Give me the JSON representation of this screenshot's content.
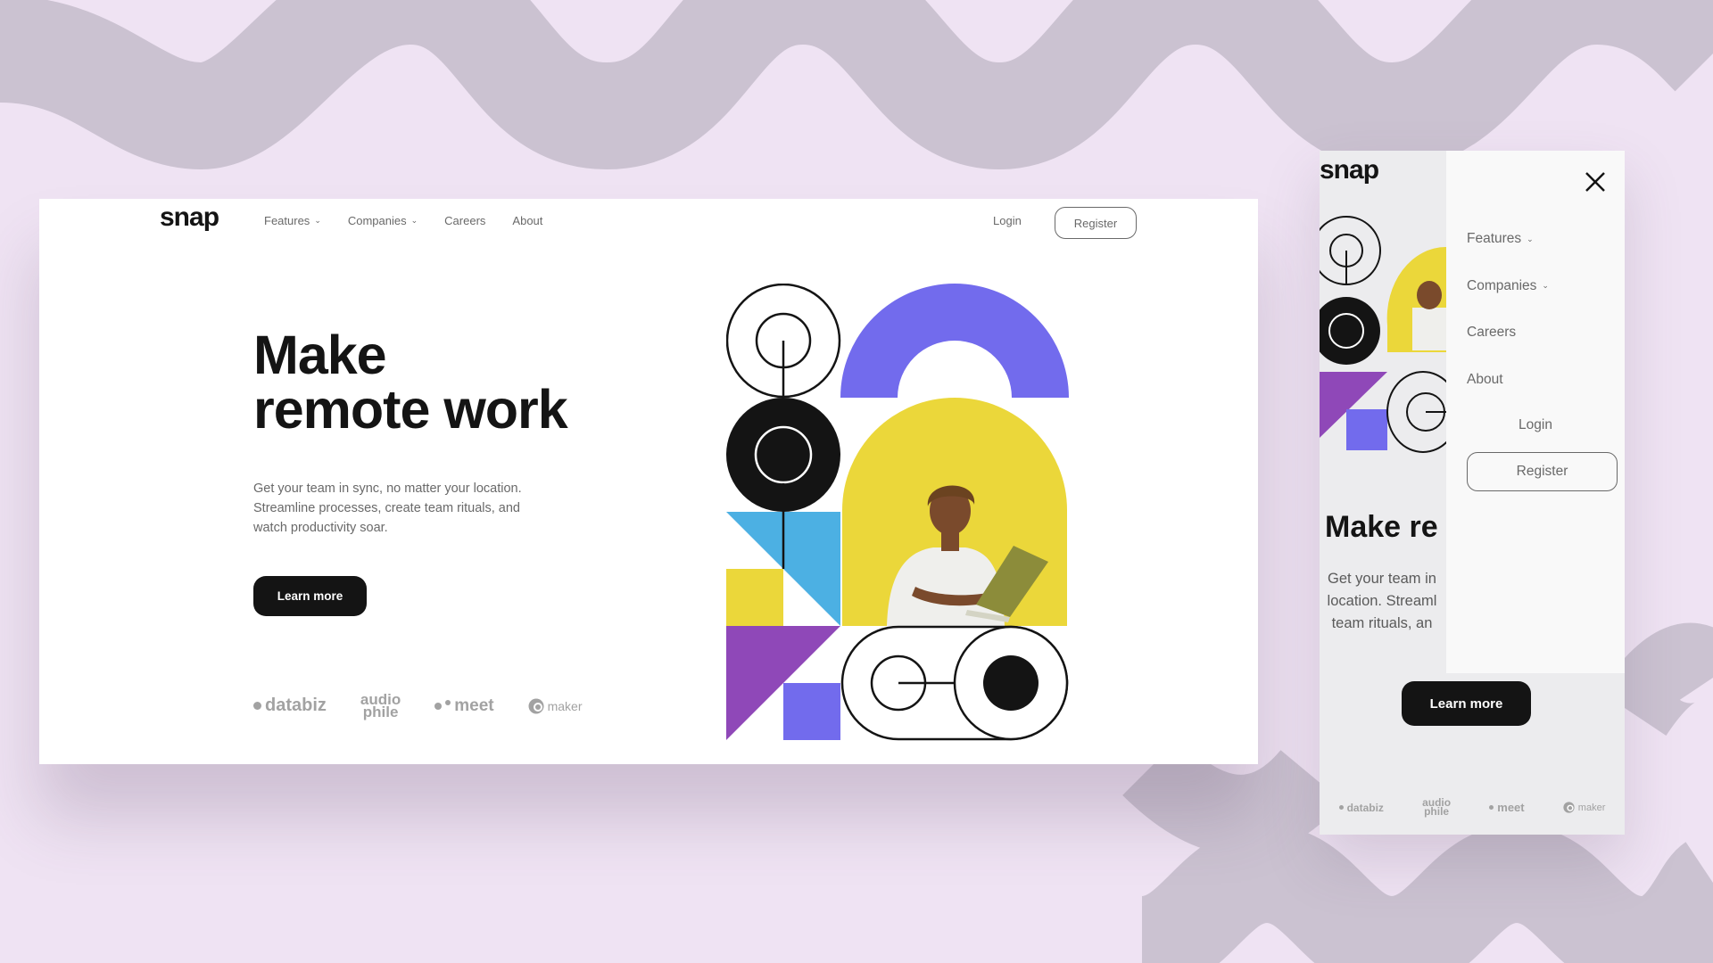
{
  "brand": {
    "logo": "snap"
  },
  "colors": {
    "background": "#efe3f3",
    "wave": "#cbc2d1",
    "dark": "#141414",
    "gray": "#696969",
    "purple": "#726bed",
    "yellow": "#ebd73a",
    "cyan": "#4cb0e3",
    "violet": "#8f48b8"
  },
  "nav": {
    "features": "Features",
    "companies": "Companies",
    "careers": "Careers",
    "about": "About",
    "chevron": "⌄"
  },
  "auth": {
    "login": "Login",
    "register": "Register"
  },
  "hero": {
    "title_line1": "Make",
    "title_line2": "remote work",
    "subtitle_line1": "Get your team in sync, no matter your location.",
    "subtitle_line2": "Streamline processes, create team rituals, and",
    "subtitle_line3": "watch productivity soar.",
    "cta": "Learn more"
  },
  "clients": {
    "databiz": "databiz",
    "audiophile_top": "audio",
    "audiophile_bottom": "phile",
    "meet": "meet",
    "maker": "maker"
  },
  "mobile": {
    "title_visible": "Make re",
    "subtitle_line1": "Get your team in",
    "subtitle_line2": "location. Streaml",
    "subtitle_line3": "team rituals, an",
    "close_icon": "close-icon"
  }
}
